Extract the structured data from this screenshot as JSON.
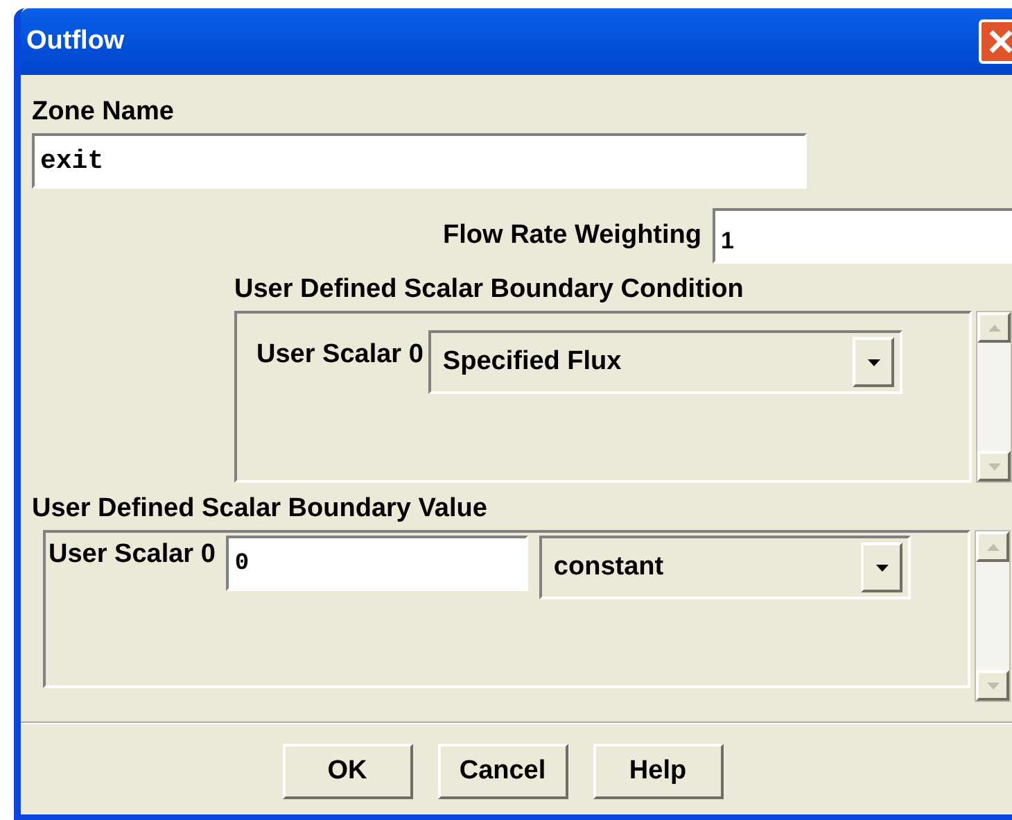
{
  "window": {
    "title": "Outflow"
  },
  "zone_name": {
    "label": "Zone Name",
    "value": "exit"
  },
  "flow_rate": {
    "label": "Flow Rate Weighting",
    "value": "1"
  },
  "condition_section": {
    "title": "User Defined Scalar Boundary Condition",
    "rows": [
      {
        "label": "User Scalar 0",
        "value": "Specified Flux"
      }
    ]
  },
  "value_section": {
    "title": "User Defined Scalar Boundary Value",
    "rows": [
      {
        "label": "User Scalar 0",
        "value": "0",
        "method": "constant"
      }
    ]
  },
  "buttons": [
    "OK",
    "Cancel",
    "Help"
  ]
}
